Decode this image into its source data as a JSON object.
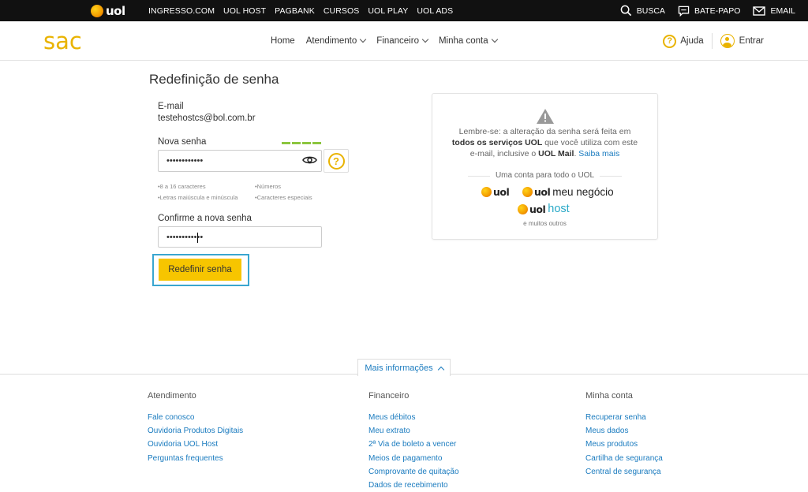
{
  "topbar": {
    "logo_text": "uol",
    "links": [
      "INGRESSO.COM",
      "UOL HOST",
      "PAGBANK",
      "CURSOS",
      "UOL PLAY",
      "UOL ADS"
    ],
    "search_label": "BUSCA",
    "chat_label": "BATE-PAPO",
    "email_label": "EMAIL"
  },
  "header": {
    "logo": "sac",
    "nav": {
      "home": "Home",
      "atendimento": "Atendimento",
      "financeiro": "Financeiro",
      "minha_conta": "Minha conta"
    },
    "help_label": "Ajuda",
    "login_label": "Entrar"
  },
  "form": {
    "title": "Redefinição de senha",
    "email_label": "E-mail",
    "email_value": "testehostcs@bol.com.br",
    "new_password_label": "Nova senha",
    "new_password_value": "••••••••••••",
    "password_strength": 1.0,
    "hints": [
      "•8 a 16 caracteres",
      "•Números",
      "•Letras maiúscula e minúscula",
      "•Caracteres especiais"
    ],
    "confirm_label": "Confirme a nova senha",
    "confirm_value": "••••••••••••",
    "submit_label": "Redefinir senha"
  },
  "info": {
    "line1": "Lembre-se: a alteração da senha será feita em",
    "line2_bold": "todos os serviços UOL",
    "line2_rest": " que você utiliza com este",
    "line3_start": "e-mail, inclusive o ",
    "line3_bold": "UOL Mail",
    "line3_link": "Saiba mais",
    "conta_label": "Uma conta para todo o UOL",
    "brand_uol": "uol",
    "brand_negocio": "meu negócio",
    "brand_host": "host",
    "outros": "e muitos outros"
  },
  "footer": {
    "mais_label": "Mais informações",
    "columns": [
      {
        "title": "Atendimento",
        "links": [
          "Fale conosco",
          "Ouvidoria Produtos Digitais",
          "Ouvidoria UOL Host",
          "Perguntas frequentes"
        ]
      },
      {
        "title": "Financeiro",
        "links": [
          "Meus débitos",
          "Meu extrato",
          "2ª Via de boleto a vencer",
          "Meios de pagamento",
          "Comprovante de quitação",
          "Dados de recebimento"
        ]
      },
      {
        "title": "Minha conta",
        "links": [
          "Recuperar senha",
          "Meus dados",
          "Meus produtos",
          "Cartilha de segurança",
          "Central de segurança"
        ]
      }
    ]
  },
  "colors": {
    "accent": "#f7c500",
    "brand": "#e9b300",
    "link": "#1a7bbf",
    "focus": "#3aa6d0",
    "strength": "#8cc63f"
  }
}
